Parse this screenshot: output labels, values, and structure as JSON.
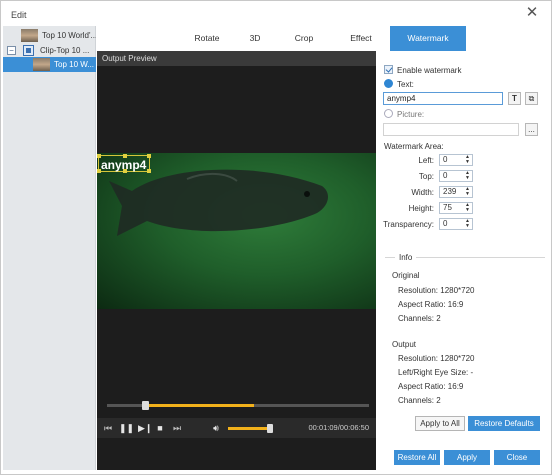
{
  "window": {
    "title": "Edit"
  },
  "tree": {
    "items": [
      {
        "label": "Top 10 World'..."
      },
      {
        "label": "Clip-Top 10 ..."
      },
      {
        "label": "Top 10 W..."
      }
    ],
    "expander": "−"
  },
  "tabs": [
    "Rotate",
    "3D",
    "Crop",
    "Effect",
    "Watermark"
  ],
  "active_tab": "Watermark",
  "preview": {
    "header": "Output Preview",
    "watermark_text": "anymp4",
    "seek_progress": 0.39,
    "volume_level": 0.95,
    "timecode": "00:01:09/00:06:50"
  },
  "settings": {
    "enable_watermark_label": "Enable watermark",
    "enable_watermark_checked": true,
    "text_label": "Text:",
    "text_value": "anymp4",
    "text_selected": true,
    "picture_label": "Picture:",
    "picture_value": "",
    "browse_label": "...",
    "font_button": "T",
    "copy_button": "⧉",
    "area_label": "Watermark Area:",
    "left_label": "Left:",
    "left_value": "0",
    "top_label": "Top:",
    "top_value": "0",
    "width_label": "Width:",
    "width_value": "239",
    "height_label": "Height:",
    "height_value": "75",
    "transparency_label": "Transparency:",
    "transparency_value": "0"
  },
  "info": {
    "legend": "Info",
    "original_title": "Original",
    "original_resolution": "Resolution: 1280*720",
    "original_aspect": "Aspect Ratio: 16:9",
    "original_channels": "Channels: 2",
    "output_title": "Output",
    "output_resolution": "Resolution: 1280*720",
    "output_eye": "Left/Right Eye Size: -",
    "output_aspect": "Aspect Ratio: 16:9",
    "output_channels": "Channels: 2"
  },
  "buttons": {
    "apply_to_all": "Apply to All",
    "restore_defaults": "Restore Defaults",
    "restore_all": "Restore All",
    "apply": "Apply",
    "close": "Close"
  },
  "colors": {
    "accent": "#3b8fd6",
    "progress": "#f2b11b",
    "watermark_box": "#d6c53a"
  }
}
